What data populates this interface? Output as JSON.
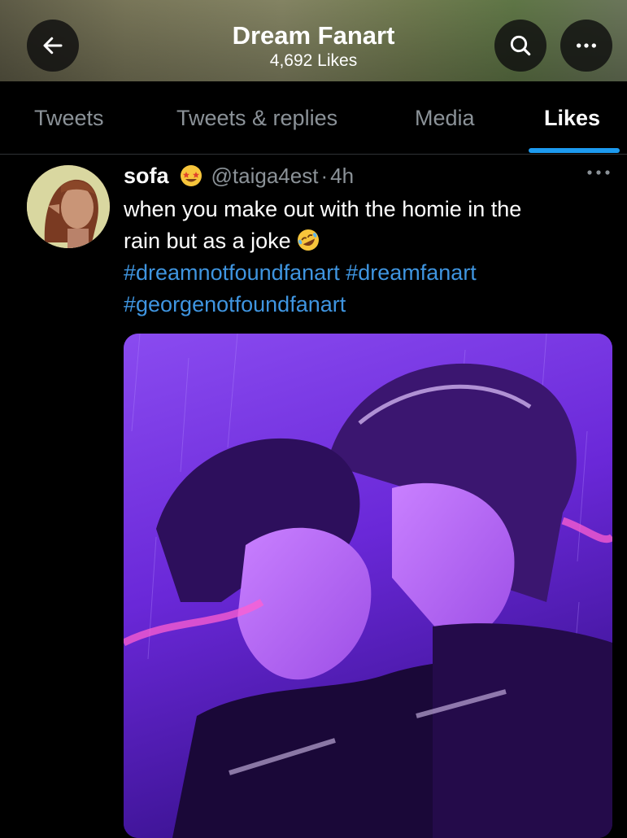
{
  "header": {
    "title": "Dream Fanart",
    "subtitle": "4,692 Likes",
    "back_icon": "arrow-left-icon",
    "search_icon": "search-icon",
    "more_icon": "more-horizontal-icon"
  },
  "tabs": [
    {
      "label": "Tweets",
      "active": false
    },
    {
      "label": "Tweets & replies",
      "active": false
    },
    {
      "label": "Media",
      "active": false
    },
    {
      "label": "Likes",
      "active": true
    }
  ],
  "tweet": {
    "author_name": "sofa",
    "author_badge_icon": "star-struck-emoji-icon",
    "handle": "@taiga4est",
    "separator": "·",
    "time": "4h",
    "text_line1": "when you make out with the homie in the",
    "text_line2": "rain but as a joke",
    "text_emoji_icon": "rolling-on-floor-laughing-emoji-icon",
    "hashtags": [
      "#dreamnotfoundfanart",
      "#dreamfanart",
      "#georgenotfoundfanart"
    ],
    "media_icon": "fanart-illustration"
  },
  "colors": {
    "accent": "#1d9bf0",
    "hashtag": "#3f95e0",
    "secondary_text": "#8b9298",
    "background": "#000000"
  }
}
